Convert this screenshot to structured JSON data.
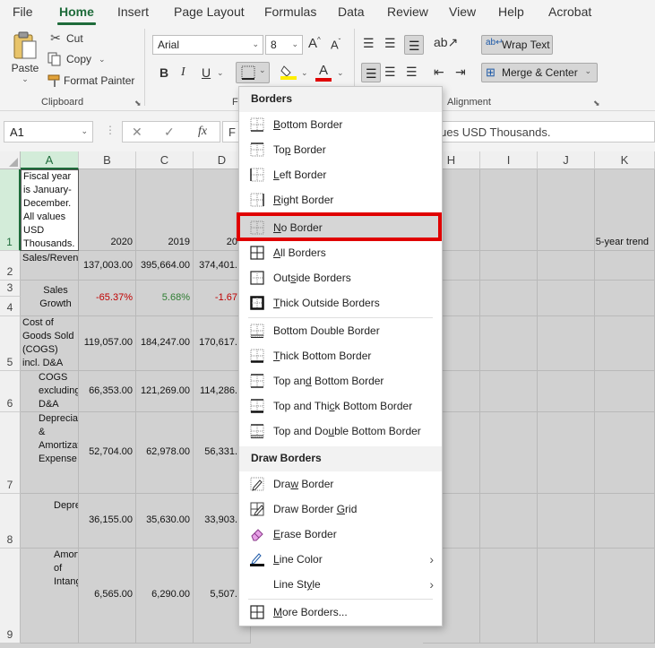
{
  "tabs": [
    "File",
    "Home",
    "Insert",
    "Page Layout",
    "Formulas",
    "Data",
    "Review",
    "View",
    "Help",
    "Acrobat"
  ],
  "active_tab": "Home",
  "clipboard": {
    "paste": "Paste",
    "cut": "Cut",
    "copy": "Copy",
    "format_painter": "Format Painter",
    "group_label": "Clipboard"
  },
  "font": {
    "name": "Arial",
    "size": "8",
    "group_label": "F",
    "bold": "B",
    "italic": "I",
    "underline": "U",
    "grow": "A",
    "shrink": "A",
    "font_color_letter": "A"
  },
  "alignment": {
    "wrap_text": "Wrap Text",
    "merge_center": "Merge & Center",
    "group_label": "Alignment"
  },
  "formula_bar": {
    "name_box": "A1",
    "fx": "fx",
    "content_left": "F",
    "content_right": "alues USD Thousands."
  },
  "columns": [
    "A",
    "B",
    "C",
    "D",
    "H",
    "I",
    "J",
    "K"
  ],
  "rows": [
    "1",
    "2",
    "3",
    "4",
    "5",
    "6",
    "7",
    "8",
    "9"
  ],
  "cells": {
    "a1": "Fiscal year is January-December. All values USD Thousands.",
    "b1": "2020",
    "c1": "2019",
    "d1": "20",
    "k1": "5-year trend",
    "a2": "Sales/Revenue",
    "b2": "137,003.00",
    "c2": "395,664.00",
    "d2": "374,401.",
    "a3": "Sales Growth",
    "b3": "-65.37%",
    "c3": "5.68%",
    "d3": "-1.67",
    "a5": "Cost of Goods Sold (COGS) incl. D&A",
    "b5": "119,057.00",
    "c5": "184,247.00",
    "d5": "170,617.",
    "a6": "COGS excluding D&A",
    "b6": "66,353.00",
    "c6": "121,269.00",
    "d6": "114,286.",
    "a7": "Depreciation & Amortization Expense",
    "b7": "52,704.00",
    "c7": "62,978.00",
    "d7": "56,331.",
    "a8": "Depreciation",
    "b8": "36,155.00",
    "c8": "35,630.00",
    "d8": "33,903.",
    "a9": "Amortization of Intangibles",
    "b9": "6,565.00",
    "c9": "6,290.00",
    "d9": "5,507."
  },
  "borders_menu": {
    "title": "Borders",
    "items": [
      {
        "pre": "",
        "u": "B",
        "post": "ottom Border"
      },
      {
        "pre": "To",
        "u": "p",
        "post": " Border"
      },
      {
        "pre": "",
        "u": "L",
        "post": "eft Border"
      },
      {
        "pre": "",
        "u": "R",
        "post": "ight Border"
      },
      {
        "pre": "",
        "u": "N",
        "post": "o Border"
      },
      {
        "pre": "",
        "u": "A",
        "post": "ll Borders"
      },
      {
        "pre": "Out",
        "u": "s",
        "post": "ide Borders"
      },
      {
        "pre": "",
        "u": "T",
        "post": "hick Outside Borders"
      },
      {
        "pre": "Bottom Double Border",
        "u": "",
        "post": ""
      },
      {
        "pre": "",
        "u": "T",
        "post": "hick Bottom Border"
      },
      {
        "pre": "Top an",
        "u": "d",
        "post": " Bottom Border"
      },
      {
        "pre": "Top and Thi",
        "u": "c",
        "post": "k Bottom Border"
      },
      {
        "pre": "Top and Do",
        "u": "u",
        "post": "ble Bottom Border"
      }
    ],
    "draw_title": "Draw Borders",
    "draw_items": [
      {
        "pre": "Dra",
        "u": "w",
        "post": " Border"
      },
      {
        "pre": "Draw Border ",
        "u": "G",
        "post": "rid"
      },
      {
        "pre": "",
        "u": "E",
        "post": "rase Border"
      },
      {
        "pre": "",
        "u": "L",
        "post": "ine Color"
      },
      {
        "pre": "Line St",
        "u": "y",
        "post": "le"
      },
      {
        "pre": "",
        "u": "M",
        "post": "ore Borders..."
      }
    ]
  },
  "colors": {
    "accent": "#1e6b3a",
    "highlight": "#e00000",
    "negative": "#c00000",
    "positive": "#2e7d32"
  }
}
